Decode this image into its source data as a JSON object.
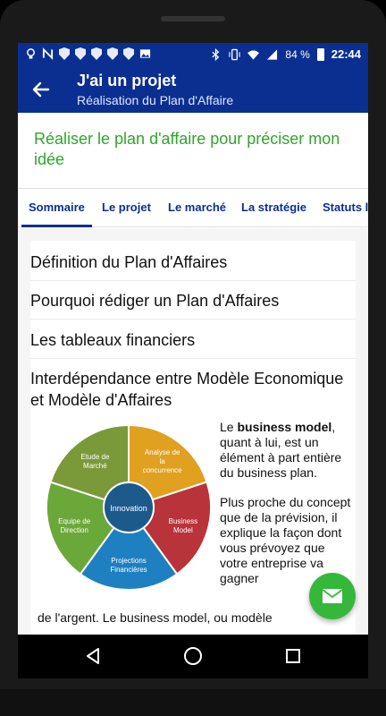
{
  "status_bar": {
    "battery_percent": "84 %",
    "time": "22:44",
    "icons": [
      "lightbulb-icon",
      "n-icon",
      "shield-icon",
      "shield-icon",
      "shield-icon",
      "shield-icon",
      "shield-icon",
      "image-icon",
      "bluetooth-icon",
      "vibrate-icon",
      "wifi-icon",
      "signal-icon",
      "battery-icon"
    ]
  },
  "app_bar": {
    "title": "J'ai un projet",
    "subtitle": "Réalisation du Plan d'Affaire",
    "back_icon": "arrow-left-icon"
  },
  "headline": "Réaliser le plan d'affaire pour préciser mon idée",
  "tabs": [
    {
      "label": "Sommaire",
      "active": true
    },
    {
      "label": "Le projet",
      "active": false
    },
    {
      "label": "Le marché",
      "active": false
    },
    {
      "label": "La stratégie",
      "active": false
    },
    {
      "label": "Statuts le",
      "active": false
    }
  ],
  "sections": [
    "Définition du Plan d'Affaires",
    "Pourquoi rédiger un Plan d'Affaires",
    "Les tableaux financiers",
    "Interdépendance entre Modèle Economique et Modèle d'Affaires"
  ],
  "diagram": {
    "center": "Innovation",
    "segments": [
      {
        "label": "Analyse de la concurrence",
        "color": "#e0a020"
      },
      {
        "label": "Business Model",
        "color": "#b8333a"
      },
      {
        "label": "Projections Financières",
        "color": "#1e80c0"
      },
      {
        "label": "Equipe de Direction",
        "color": "#6aa83a"
      },
      {
        "label": "Etude de Marché",
        "color": "#7a9a3a"
      }
    ],
    "center_color": "#1d5a8c"
  },
  "paragraph1": {
    "prefix": "Le ",
    "bold": "business model",
    "suffix": ", quant à lui, est un élément à part entière du business plan."
  },
  "paragraph2": "Plus proche du concept que de la prévision, il explique la façon dont vous prévoyez que votre entreprise va gagner",
  "paragraph_bottom": "de l'argent. Le business model, ou modèle",
  "fab": {
    "icon": "mail-icon"
  },
  "nav": {
    "icons": [
      "back-triangle-icon",
      "home-circle-icon",
      "recents-square-icon"
    ]
  },
  "colors": {
    "primary": "#0b2f91",
    "accent": "#2fa52a",
    "fab": "#35b83a"
  }
}
